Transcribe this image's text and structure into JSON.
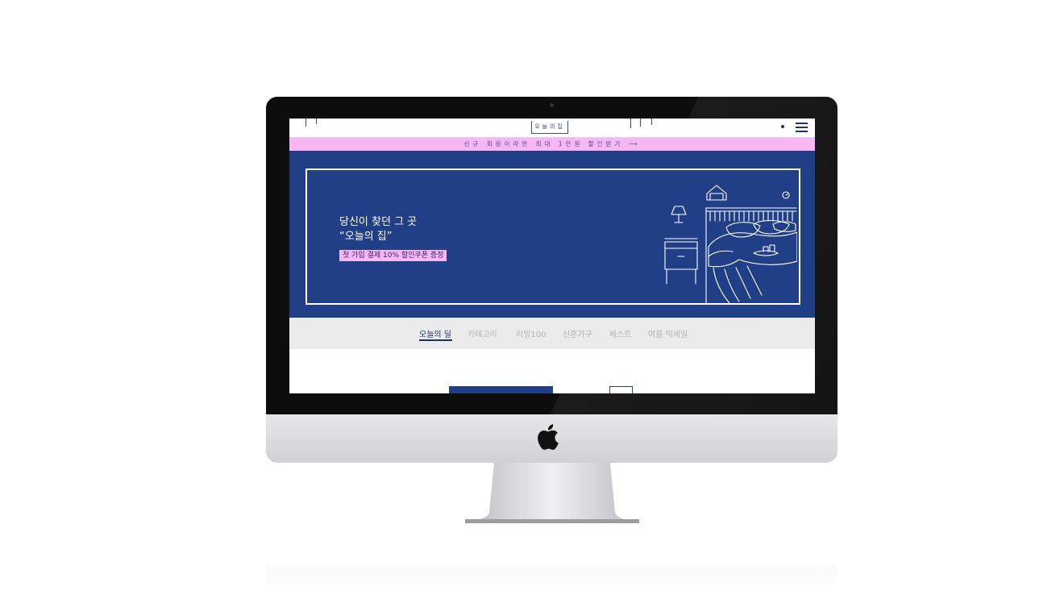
{
  "site": {
    "logo_text": "오늘의집",
    "promo_text": "신규 회원이라면 최대 1만원 할인받기 ⟶",
    "hero": {
      "title_line1": "당신이 찾던 그 곳",
      "title_line2": "“오늘의 집”",
      "badge": "첫 가입 결제 10% 할인쿠폰 증정"
    },
    "tabs": [
      {
        "label": "오늘의 딜",
        "active": true
      },
      {
        "label": "카테고리",
        "active": false
      },
      {
        "label": "리빙100",
        "active": false
      },
      {
        "label": "신혼가구",
        "active": false
      },
      {
        "label": "베스트",
        "active": false
      },
      {
        "label": "여름 빅세일",
        "active": false
      }
    ]
  },
  "colors": {
    "brand_navy": "#213f86",
    "promo_pink": "#f8b6f3",
    "tab_bar": "#ebebeb"
  },
  "icons": [
    "menu-icon",
    "apple-logo",
    "bedroom-illustration"
  ]
}
